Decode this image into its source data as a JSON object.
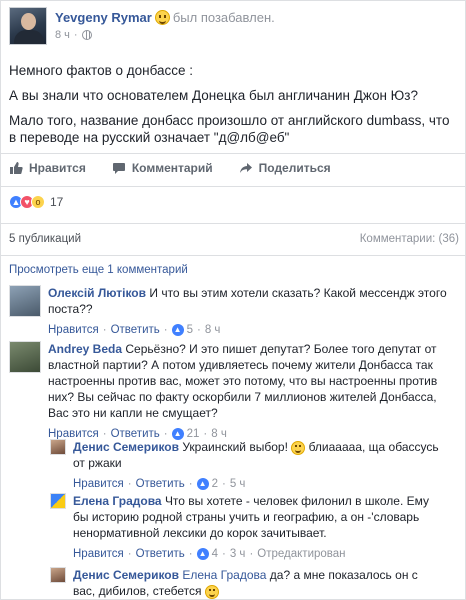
{
  "post": {
    "author": "Yevgeny Rymar",
    "status": "был позабавлен.",
    "time": "8 ч",
    "paragraphs": [
      "Немного фактов о донбассе :",
      "А вы знали что основателем Донецка был англичанин Джон Юз?",
      "Мало того, название донбасс произошло от английского dumbass, что в переводе на русский означает \"д@лб@еб\""
    ]
  },
  "actions": {
    "like": "Нравится",
    "comment": "Комментарий",
    "share": "Поделиться"
  },
  "reactions": {
    "count": "17",
    "types": [
      "like-reaction-icon",
      "love-reaction-icon",
      "wow-reaction-icon"
    ]
  },
  "shares": {
    "label": "5 публикаций",
    "comments_label": "Комментарии: (36)"
  },
  "view_more": "Просмотреть еще 1 комментарий",
  "comments": [
    {
      "author": "Олексій Лютіков",
      "text": "И что вы этим хотели сказать? Какой мессендж этого поста??",
      "like": "Нравится",
      "reply": "Ответить",
      "likes": "5",
      "time": "8 ч"
    },
    {
      "author": "Andrey Beda",
      "text": "Серьёзно? И это пишет депутат? Более того депутат от властной партии? А потом удивляетесь почему жители Донбасса так настроенны против вас, может это потому, что вы настроенны против них? Вы сейчас по факту оскорбили 7 миллионов жителей Донбасса, Вас это ни капли не смущает?",
      "like": "Нравится",
      "reply": "Ответить",
      "likes": "21",
      "time": "8 ч"
    }
  ],
  "replies": [
    {
      "author": "Денис Семериков",
      "text_before": "Украинский выбор!",
      "text_after": "блиааааа, ща обассусь от ржаки",
      "like": "Нравится",
      "reply": "Ответить",
      "likes": "2",
      "time": "5 ч"
    },
    {
      "author": "Елена Градова",
      "text": "Что вы хотете - человек филонил в школе. Ему бы историю родной страны учить и географию, а он -'словарь ненормативной лексики до корок зачитывает.",
      "like": "Нравится",
      "reply": "Ответить",
      "likes": "4",
      "time": "3 ч",
      "edited": "Отредактирован"
    },
    {
      "author": "Денис Семериков",
      "mention": "Елена Градова",
      "text": "да? а мне показалось он с вас, дибилов, стебется"
    }
  ]
}
